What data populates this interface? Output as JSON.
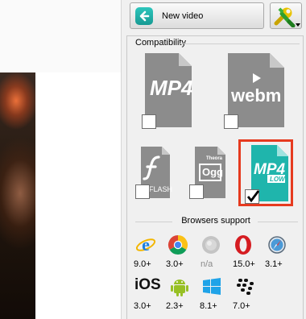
{
  "toolbar": {
    "new_video_label": "New video",
    "back_icon": "back-arrow-icon",
    "tools_icon": "wrench-icon",
    "accent_color": "#1fb5ac"
  },
  "compatibility": {
    "title": "Compatibility",
    "formats": [
      {
        "name": "MP4",
        "checked": false,
        "selected": false
      },
      {
        "name": "webm",
        "checked": false,
        "selected": false
      },
      {
        "name": "FLASH",
        "checked": false,
        "selected": false
      },
      {
        "name": "Ogg",
        "subname": "Theora",
        "checked": false,
        "selected": false
      },
      {
        "name": "MP4",
        "subname": "LOW",
        "checked": true,
        "selected": true
      }
    ],
    "selected_border_color": "#e63a1f"
  },
  "browsers": {
    "title": "Browsers support",
    "items": [
      {
        "name": "Internet Explorer",
        "icon": "ie-icon",
        "version": "9.0+"
      },
      {
        "name": "Chrome",
        "icon": "chrome-icon",
        "version": "3.0+"
      },
      {
        "name": "Unknown",
        "icon": "disabled-browser-icon",
        "version": "n/a"
      },
      {
        "name": "Opera",
        "icon": "opera-icon",
        "version": "15.0+"
      },
      {
        "name": "Safari",
        "icon": "safari-icon",
        "version": "3.1+"
      },
      {
        "name": "iOS",
        "icon": "ios-icon",
        "label": "iOS",
        "version": "3.0+"
      },
      {
        "name": "Android",
        "icon": "android-icon",
        "version": "2.3+"
      },
      {
        "name": "Windows",
        "icon": "windows-icon",
        "version": "8.1+"
      },
      {
        "name": "BlackBerry",
        "icon": "blackberry-icon",
        "version": "7.0+"
      }
    ]
  }
}
